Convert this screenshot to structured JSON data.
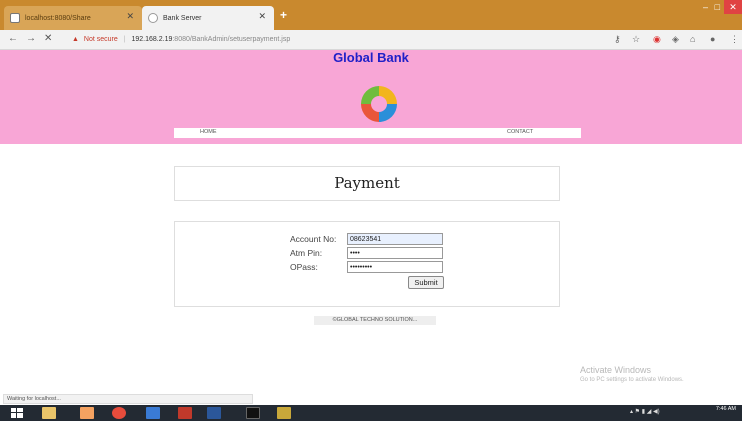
{
  "tabs": [
    {
      "label": "localhost:8080/Share"
    },
    {
      "label": "Bank Server"
    }
  ],
  "address": {
    "warning": "Not secure",
    "host": "192.168.2.19",
    "path": ":8080/BankAdmin/setuserpayment.jsp"
  },
  "header": {
    "brand": "Global Bank",
    "nav": {
      "home": "HOME",
      "contact": "CONTACT"
    }
  },
  "payment": {
    "title": "Payment",
    "fields": {
      "account_label": "Account No:",
      "account_value": "08623541",
      "pin_label": "Atm Pin:",
      "pin_value": "••••",
      "opass_label": "OPass:",
      "opass_value": "•••••••••"
    },
    "submit_label": "Submit"
  },
  "footer": "©GLOBAL TECHNO SOLUTION...",
  "status_text": "Waiting for localhost...",
  "activate": {
    "line1": "Activate Windows",
    "line2": "Go to PC settings to activate Windows."
  },
  "clock": {
    "time": "7:46 AM"
  },
  "colors": {
    "header_bg": "#f8a6d6",
    "brand": "#2020c8",
    "tabstrip": "#c9892e"
  }
}
